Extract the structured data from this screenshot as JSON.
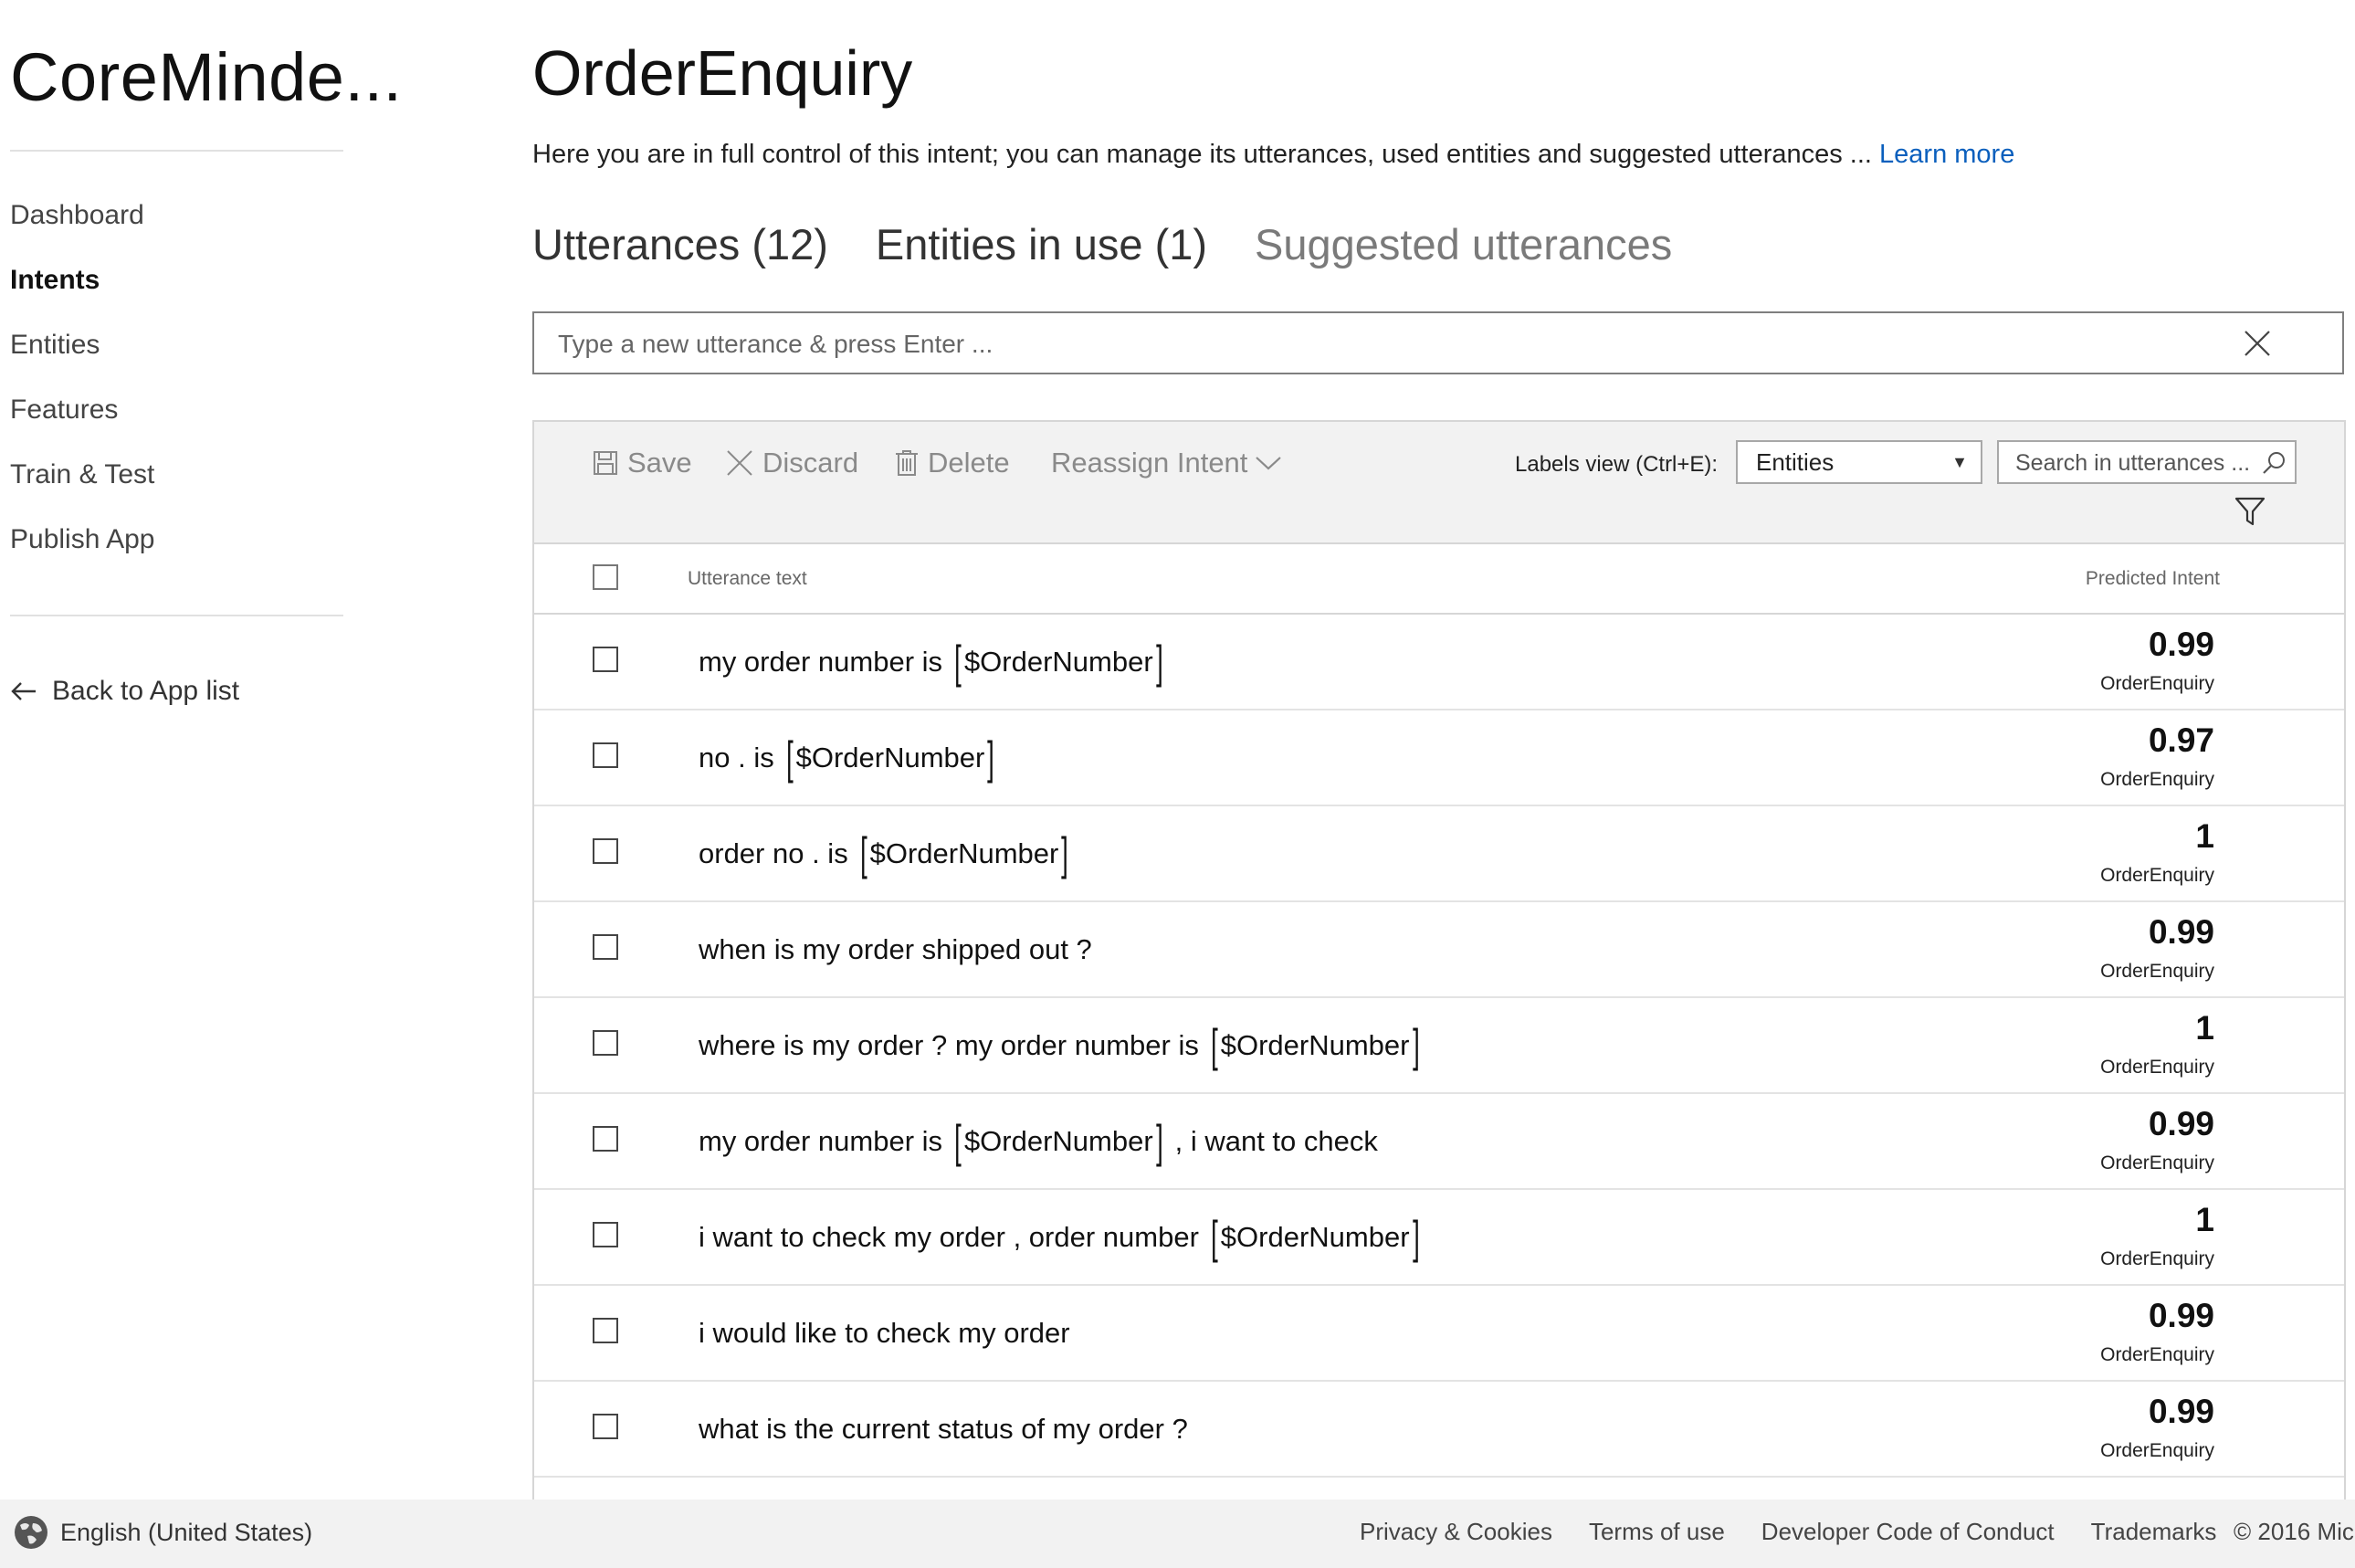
{
  "app": {
    "name": "CoreMinde..."
  },
  "sidebar": {
    "items": [
      {
        "label": "Dashboard",
        "active": false
      },
      {
        "label": "Intents",
        "active": true
      },
      {
        "label": "Entities",
        "active": false
      },
      {
        "label": "Features",
        "active": false
      },
      {
        "label": "Train & Test",
        "active": false
      },
      {
        "label": "Publish App",
        "active": false
      }
    ],
    "back_label": "Back to App list"
  },
  "intent": {
    "title": "OrderEnquiry",
    "description": "Here you are in full control of this intent; you can manage its utterances, used entities and suggested utterances ... ",
    "learn_more": "Learn more"
  },
  "tabs": [
    {
      "label": "Utterances (12)",
      "active": true
    },
    {
      "label": "Entities in use (1)",
      "active": false
    },
    {
      "label": "Suggested utterances",
      "active": false
    }
  ],
  "new_utterance": {
    "placeholder": "Type a new utterance & press Enter ..."
  },
  "toolbar": {
    "save": "Save",
    "discard": "Discard",
    "delete": "Delete",
    "reassign": "Reassign Intent",
    "labels_view_label": "Labels view (Ctrl+E):",
    "labels_view_value": "Entities",
    "search_placeholder": "Search in utterances ..."
  },
  "grid": {
    "col_text": "Utterance text",
    "col_intent": "Predicted Intent",
    "rows": [
      {
        "segments": [
          {
            "t": "my order number is"
          },
          {
            "e": "$OrderNumber"
          }
        ],
        "score": "0.99",
        "intent": "OrderEnquiry"
      },
      {
        "segments": [
          {
            "t": "no . is"
          },
          {
            "e": "$OrderNumber"
          }
        ],
        "score": "0.97",
        "intent": "OrderEnquiry"
      },
      {
        "segments": [
          {
            "t": "order no . is"
          },
          {
            "e": "$OrderNumber"
          }
        ],
        "score": "1",
        "intent": "OrderEnquiry"
      },
      {
        "segments": [
          {
            "t": "when is my order shipped out ?"
          }
        ],
        "score": "0.99",
        "intent": "OrderEnquiry"
      },
      {
        "segments": [
          {
            "t": "where is my order ? my order number is"
          },
          {
            "e": "$OrderNumber"
          }
        ],
        "score": "1",
        "intent": "OrderEnquiry"
      },
      {
        "segments": [
          {
            "t": "my order number is"
          },
          {
            "e": "$OrderNumber"
          },
          {
            "t": ", i want to check"
          }
        ],
        "score": "0.99",
        "intent": "OrderEnquiry"
      },
      {
        "segments": [
          {
            "t": "i want to check my order , order number"
          },
          {
            "e": "$OrderNumber"
          }
        ],
        "score": "1",
        "intent": "OrderEnquiry"
      },
      {
        "segments": [
          {
            "t": "i would like to check my order"
          }
        ],
        "score": "0.99",
        "intent": "OrderEnquiry"
      },
      {
        "segments": [
          {
            "t": "what is the current status of my order ?"
          }
        ],
        "score": "0.99",
        "intent": "OrderEnquiry"
      }
    ]
  },
  "footer": {
    "language": "English (United States)",
    "links": [
      "Privacy & Cookies",
      "Terms of use",
      "Developer Code of Conduct",
      "Trademarks"
    ],
    "copyright": "© 2016 Mic"
  }
}
